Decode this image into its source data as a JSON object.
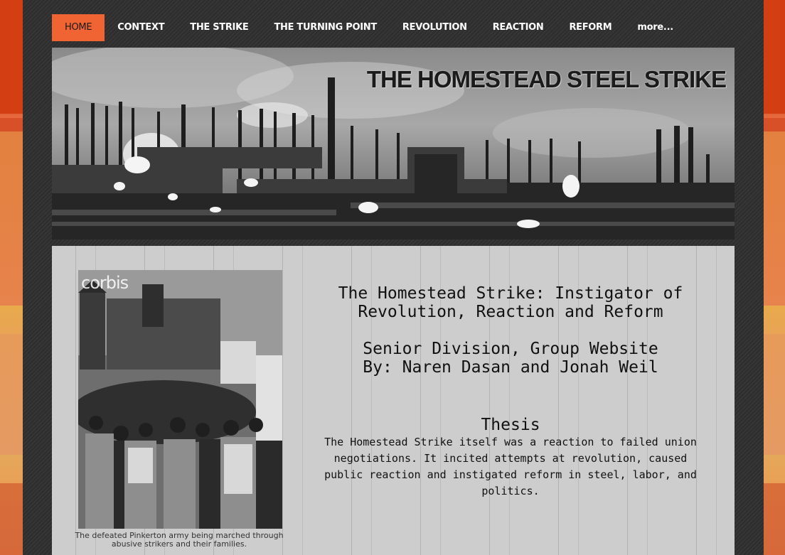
{
  "nav": {
    "items": [
      {
        "label": "HOME",
        "active": true
      },
      {
        "label": "CONTEXT",
        "active": false
      },
      {
        "label": "THE STRIKE",
        "active": false
      },
      {
        "label": "THE TURNING POINT",
        "active": false
      },
      {
        "label": "REVOLUTION",
        "active": false
      },
      {
        "label": "REACTION",
        "active": false
      },
      {
        "label": "REFORM",
        "active": false
      },
      {
        "label": "more...",
        "active": false
      }
    ]
  },
  "banner": {
    "title": "THE HOMESTEAD STEEL STRIKE"
  },
  "figure": {
    "watermark": "corbis",
    "caption": "The defeated Pinkerton army being marched through abusive strikers and their families."
  },
  "main": {
    "heading_line1": "The Homestead Strike: Instigator of",
    "heading_line2": "Revolution, Reaction and Reform",
    "sub_line1": "Senior Division, Group Website",
    "sub_line2": "By: Naren Dasan and Jonah Weil",
    "thesis_title": "Thesis",
    "thesis_body": "The Homestead Strike itself was a reaction to failed union negotiations. It incited attempts at revolution, caused public reaction and instigated reform in steel, labor, and politics."
  },
  "colors": {
    "accent": "#f06433",
    "frame": "#2d2d2d",
    "content_bg": "#cdcdcd"
  }
}
